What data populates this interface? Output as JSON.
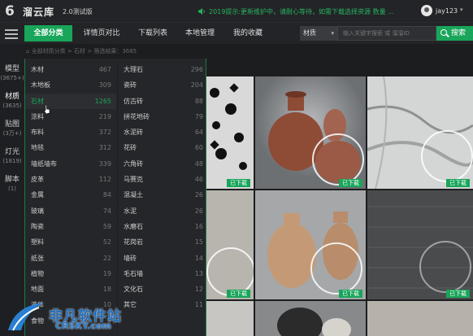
{
  "app": {
    "title": "溜云库",
    "version": "2.0测试版",
    "notice": "2019提示:更新维护中，请耐心等待，如需下载选择资源 数量 ..."
  },
  "user": {
    "name": "jay123"
  },
  "nav": {
    "tabs": [
      {
        "label": "全部分类",
        "active": true
      },
      {
        "label": "详情页对比"
      },
      {
        "label": "下载列表"
      },
      {
        "label": "本地管理"
      },
      {
        "label": "我的收藏"
      }
    ]
  },
  "search": {
    "filter": "材质",
    "placeholder": "输入关键字搜索 或 溜溜ID",
    "button": "搜索"
  },
  "rail": {
    "items": [
      {
        "label": "模型",
        "count": "(3675+)"
      },
      {
        "label": "材质",
        "count": "(3635)"
      },
      {
        "label": "贴图",
        "count": "(3万+)"
      },
      {
        "label": "灯光",
        "count": "(1819)"
      },
      {
        "label": "脚本",
        "count": "(1)"
      }
    ]
  },
  "breadcrumb": {
    "text": "全部材质分类  >  石材  >  筛选结果：3685"
  },
  "categories": {
    "left": [
      {
        "name": "木材",
        "count": "467"
      },
      {
        "name": "木地板",
        "count": "309"
      },
      {
        "name": "石材",
        "count": "1265",
        "selected": true
      },
      {
        "name": "涂料",
        "count": "219"
      },
      {
        "name": "布料",
        "count": "372"
      },
      {
        "name": "地毯",
        "count": "312"
      },
      {
        "name": "墙纸墙布",
        "count": "339"
      },
      {
        "name": "皮革",
        "count": "112"
      },
      {
        "name": "金属",
        "count": "84"
      },
      {
        "name": "玻璃",
        "count": "74"
      },
      {
        "name": "陶瓷",
        "count": "59"
      },
      {
        "name": "塑料",
        "count": "52"
      },
      {
        "name": "纸张",
        "count": "22"
      },
      {
        "name": "植物",
        "count": "19"
      },
      {
        "name": "地面",
        "count": "18"
      },
      {
        "name": "液体",
        "count": "10"
      },
      {
        "name": "食物",
        "count": "9"
      }
    ],
    "right": [
      {
        "name": "大理石",
        "count": "296"
      },
      {
        "name": "瓷砖",
        "count": "204"
      },
      {
        "name": "仿古砖",
        "count": "88"
      },
      {
        "name": "拼花地砖",
        "count": "79"
      },
      {
        "name": "水泥砖",
        "count": "64"
      },
      {
        "name": "花砖",
        "count": "60"
      },
      {
        "name": "六角砖",
        "count": "48"
      },
      {
        "name": "马赛克",
        "count": "46"
      },
      {
        "name": "混凝土",
        "count": "26"
      },
      {
        "name": "水泥",
        "count": "26"
      },
      {
        "name": "水磨石",
        "count": "16"
      },
      {
        "name": "花岗岩",
        "count": "15"
      },
      {
        "name": "墙砖",
        "count": "14"
      },
      {
        "name": "毛石墙",
        "count": "13"
      },
      {
        "name": "文化石",
        "count": "12"
      },
      {
        "name": "其它",
        "count": "11"
      }
    ]
  },
  "thumbnails": {
    "badge": "已下载"
  },
  "watermark": {
    "text": "非凡软件站",
    "sub": "CRSKY.com"
  },
  "colors": {
    "accent": "#19a55a",
    "background": "#1c1d1f",
    "panel": "#252629"
  }
}
